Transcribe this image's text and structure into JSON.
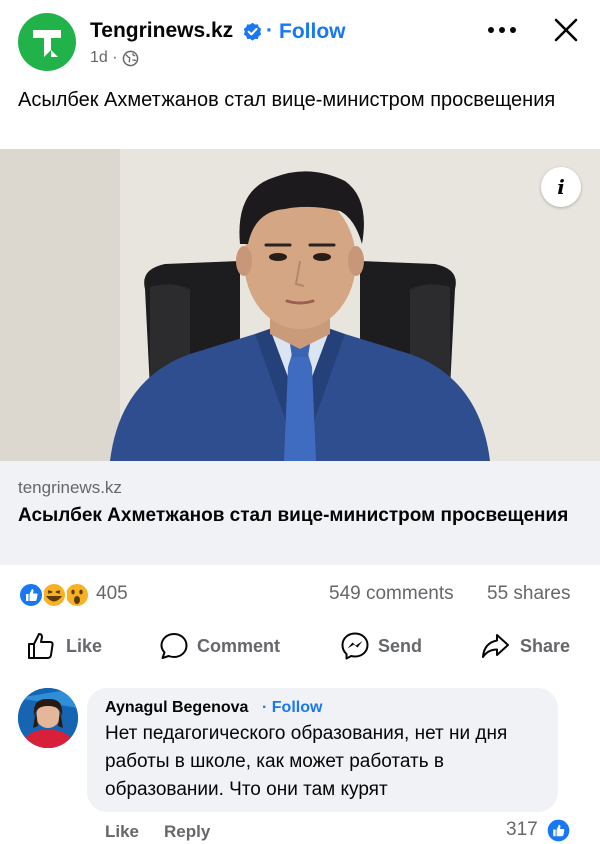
{
  "post": {
    "page_name": "Tengrinews.kz",
    "follow_label": "Follow",
    "separator": "·",
    "time": "1d ·",
    "text": "Асылбек Ахметжанов стал вице-министром просвещения",
    "icons": [
      "tengrinews-logo-icon",
      "verified-badge-icon",
      "globe-icon",
      "more-icon",
      "close-icon"
    ]
  },
  "link_preview": {
    "domain": "tengrinews.kz",
    "title": "Асылбек Ахметжанов стал вице-министром просвещения",
    "info_label": "i"
  },
  "stats": {
    "reaction_count": "405",
    "comments": "549 comments",
    "shares": "55 shares",
    "reaction_icons": [
      "like-reaction-icon",
      "haha-reaction-icon",
      "wow-reaction-icon"
    ]
  },
  "actions": {
    "like": "Like",
    "comment": "Comment",
    "send": "Send",
    "share": "Share"
  },
  "comment": {
    "author": "Aynagul  Begenova",
    "follow_label": "· Follow",
    "text": "Нет педагогического образования, нет ни дня работы в школе,  как может работать в образовании. Что они там курят",
    "like_label": "Like",
    "reply_label": "Reply",
    "like_count": "317"
  },
  "colors": {
    "brand_blue": "#1877f2",
    "logo_green": "#21b34a",
    "secondary_text": "#65676b",
    "bubble_bg": "#f0f2f5"
  }
}
